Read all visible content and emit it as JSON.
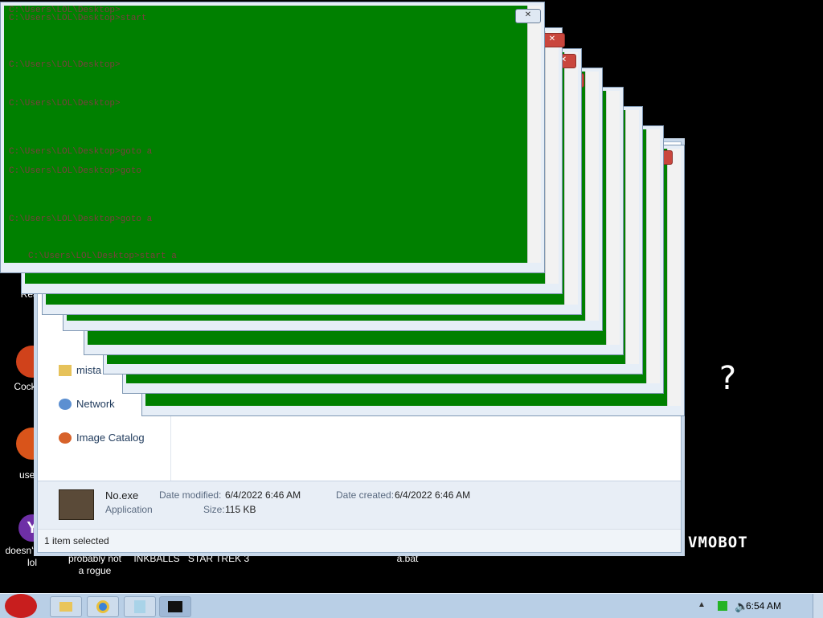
{
  "desktop": {
    "icons": [
      {
        "label": "Morbi\nRead",
        "color": "#b00d0d"
      },
      {
        "label": "CockCle",
        "color": "#d0421b"
      },
      {
        "label": "uses t",
        "color": "#d9541a"
      },
      {
        "label": "doesn't work\nlol",
        "color": "#6e2fa6"
      },
      {
        "label": "probably not\na rogue"
      },
      {
        "label": "INKBALLS"
      },
      {
        "label": "STAR TREK 3"
      },
      {
        "label": "a.bat"
      }
    ],
    "right_label": "VMOBOT",
    "question_mark": "?"
  },
  "explorer": {
    "nav": {
      "item_partial": "mista",
      "network": "Network",
      "image_catalog": "Image Catalog"
    },
    "details": {
      "filename": "No.exe",
      "type": "Application",
      "date_modified_label": "Date modified:",
      "date_modified": "6/4/2022 6:46 AM",
      "date_created_label": "Date created:",
      "date_created": "6/4/2022 6:46 AM",
      "size_label": "Size:",
      "size": "115 KB"
    },
    "status": "1 item selected"
  },
  "cmd": {
    "lines": [
      "C:\\Users\\LOL\\Desktop>",
      "C:\\Users\\LOL\\Desktop>start",
      "C:\\Users\\LOL\\Desktop>",
      "C:\\Users\\LOL\\Desktop>",
      "C:\\Users\\LOL\\Desktop>goto a",
      "C:\\Users\\LOL\\Desktop>goto",
      "C:\\Users\\LOL\\Desktop>goto a",
      "C:\\Users\\LOL\\Desktop>start a"
    ]
  },
  "taskbar": {
    "clock": "6:54 AM"
  },
  "colors": {
    "cmd_bg": "#008000",
    "close_button": "#c9463d"
  }
}
